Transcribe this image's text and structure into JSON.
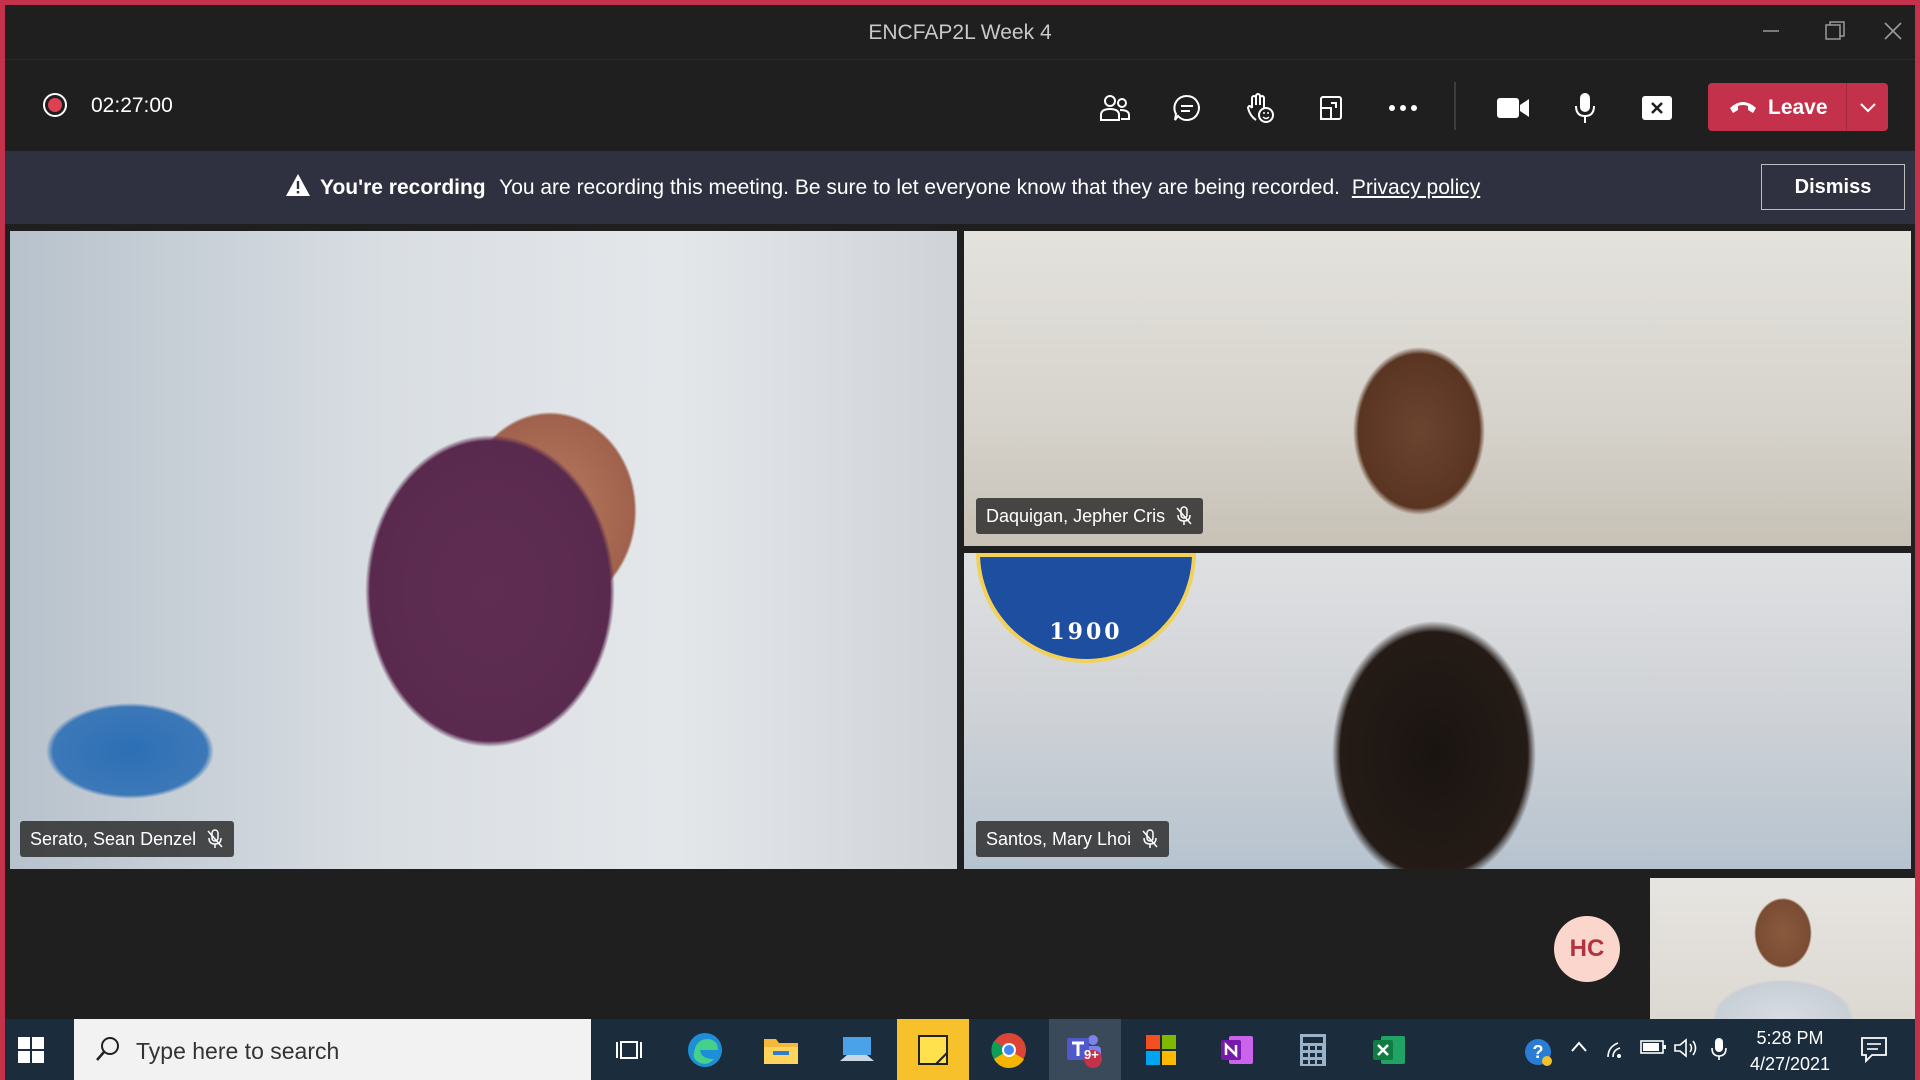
{
  "window": {
    "title": "ENCFAP2L Week 4",
    "controls": [
      "minimize",
      "restore",
      "close"
    ]
  },
  "toolbar": {
    "recording_timer": "02:27:00",
    "icons": [
      "people-icon",
      "chat-icon",
      "reactions-icon",
      "share-tray-icon",
      "more-options-icon",
      "camera-icon",
      "mic-icon",
      "stop-share-icon"
    ],
    "leave_label": "Leave",
    "leave_color": "#c4314b"
  },
  "banner": {
    "bold": "You're recording",
    "message": "You are recording this meeting. Be sure to let everyone know that they are being recorded.",
    "link": "Privacy policy",
    "dismiss": "Dismiss"
  },
  "participants": [
    {
      "name": "Serato, Sean Denzel",
      "muted": true
    },
    {
      "name": "Daquigan, Jepher Cris",
      "muted": true
    },
    {
      "name": "Santos, Mary Lhoi",
      "muted": true
    }
  ],
  "seal_text": "1900",
  "self": {
    "initials": "HC"
  },
  "taskbar": {
    "search_placeholder": "Type here to search",
    "apps": [
      "task-view",
      "edge",
      "file-explorer",
      "remote-desktop",
      "sticky-notes",
      "chrome",
      "teams",
      "microsoft-store",
      "onenote",
      "calculator",
      "excel"
    ],
    "teams_badge": "9+",
    "time": "5:28 PM",
    "date": "4/27/2021"
  }
}
